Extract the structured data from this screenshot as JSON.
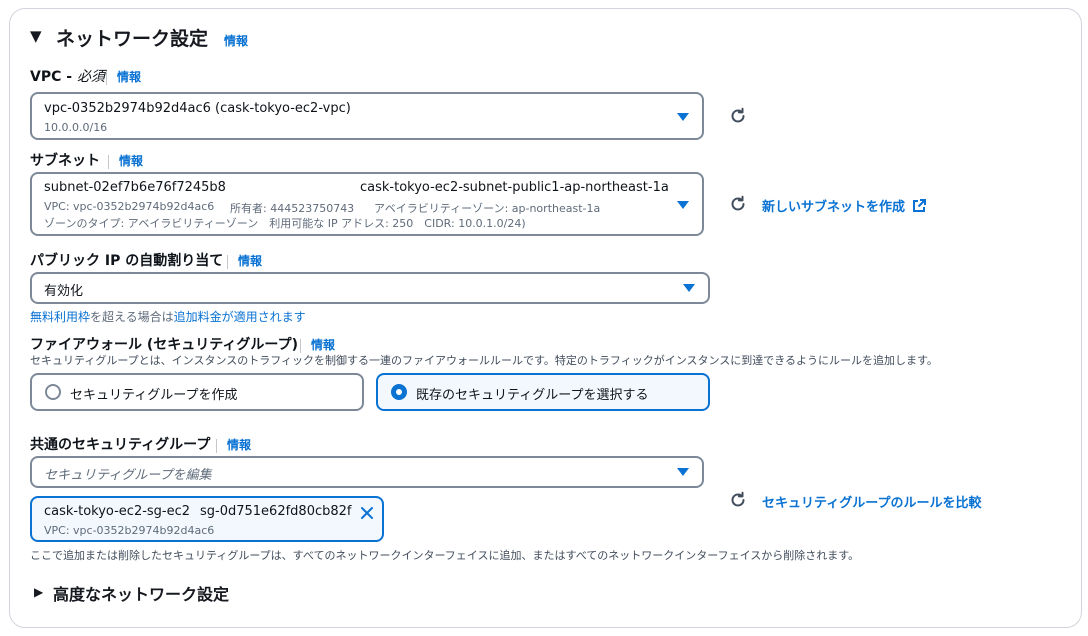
{
  "section": {
    "title": "ネットワーク設定",
    "info": "情報",
    "toggle": "▼"
  },
  "vpc": {
    "label": "VPC - ",
    "required": "必須",
    "info": "情報",
    "value": "vpc-0352b2974b92d4ac6 (cask-tokyo-ec2-vpc)",
    "cidr": "10.0.0.0/16"
  },
  "subnet": {
    "label": "サブネット",
    "info": "情報",
    "id": "subnet-02ef7b6e76f7245b8",
    "name": "cask-tokyo-ec2-subnet-public1-ap-northeast-1a",
    "line1_vpc": "VPC: vpc-0352b2974b92d4ac6",
    "line1_owner": "所有者: 444523750743",
    "line1_az": "アベイラビリティーゾーン: ap-northeast-1a",
    "line2": "ゾーンのタイプ: アベイラビリティーゾーン　利用可能な IP アドレス: 250　CIDR: 10.0.1.0/24)",
    "create_link": "新しいサブネットを作成"
  },
  "public_ip": {
    "label": "パブリック IP の自動割り当て",
    "info": "情報",
    "value": "有効化",
    "note_link1": "無料利用枠",
    "note_mid": "を超える場合は",
    "note_link2": "追加料金が適用されます"
  },
  "firewall": {
    "label": "ファイアウォール (セキュリティグループ)",
    "info": "情報",
    "description": "セキュリティグループとは、インスタンスのトラフィックを制御する一連のファイアウォールルールです。特定のトラフィックがインスタンスに到達できるようにルールを追加します。",
    "option_create": "セキュリティグループを作成",
    "option_existing": "既存のセキュリティグループを選択する"
  },
  "common_sg": {
    "label": "共通のセキュリティグループ",
    "info": "情報",
    "placeholder": "セキュリティグループを編集",
    "token_name": "cask-tokyo-ec2-sg-ec2",
    "token_id": "sg-0d751e62fd80cb82f",
    "token_vpc": "VPC: vpc-0352b2974b92d4ac6",
    "compare_link": "セキュリティグループのルールを比較",
    "footnote": "ここで追加または削除したセキュリティグループは、すべてのネットワークインターフェイスに追加、またはすべてのネットワークインターフェイスから削除されます。"
  },
  "advanced": {
    "title": "高度なネットワーク設定",
    "toggle": "▶"
  },
  "colors": {
    "accent": "#0972d3",
    "border": "#7d8998",
    "text": "#0f141a",
    "muted": "#5f6b7a"
  },
  "icons": [
    "caret-down-icon",
    "refresh-icon",
    "external-link-icon",
    "close-icon"
  ]
}
